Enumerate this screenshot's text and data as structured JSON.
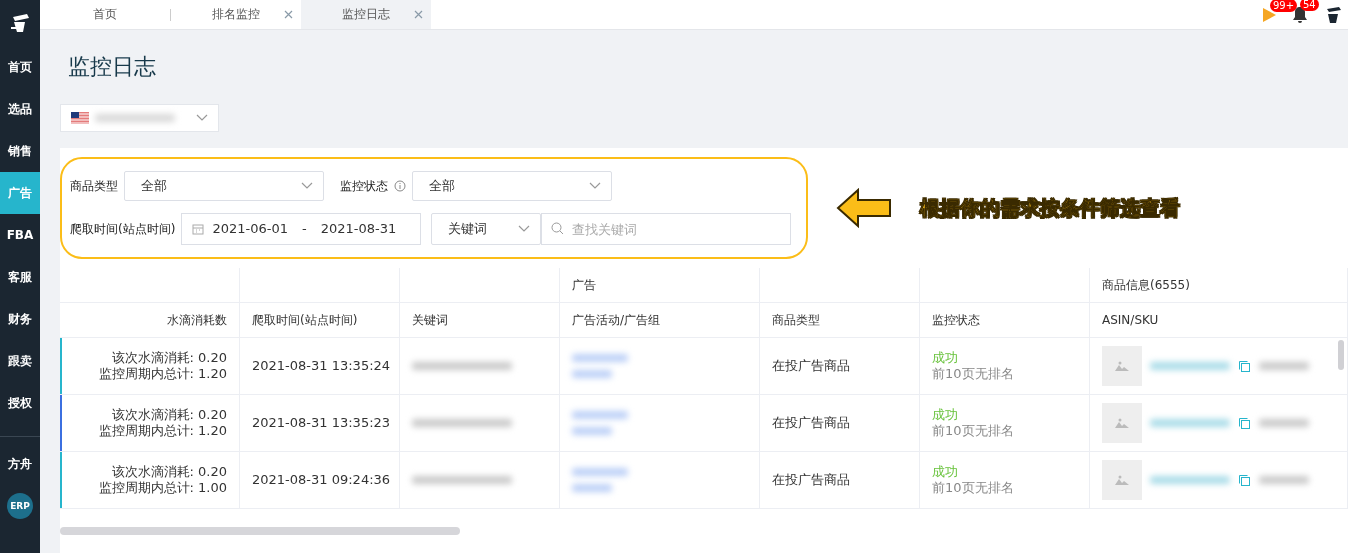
{
  "sidebar": {
    "items": [
      {
        "label": "首页",
        "selected": false
      },
      {
        "label": "选品",
        "selected": false
      },
      {
        "label": "销售",
        "selected": false
      },
      {
        "label": "广告",
        "selected": true
      },
      {
        "label": "FBA",
        "selected": false
      },
      {
        "label": "客服",
        "selected": false
      },
      {
        "label": "财务",
        "selected": false
      },
      {
        "label": "跟卖",
        "selected": false
      },
      {
        "label": "授权",
        "selected": false
      }
    ],
    "extra": [
      {
        "label": "方舟",
        "kind": "text"
      },
      {
        "label": "ERP",
        "kind": "badge"
      }
    ]
  },
  "tabs": [
    {
      "label": "首页",
      "selected": false,
      "closable": false
    },
    {
      "label": "排名监控",
      "selected": false,
      "closable": true
    },
    {
      "label": "监控日志",
      "selected": true,
      "closable": true
    }
  ],
  "header": {
    "flag_badge": "99+",
    "bell_badge": "54"
  },
  "page_title": "监控日志",
  "filters": {
    "product_type": {
      "label": "商品类型",
      "value": "全部"
    },
    "status": {
      "label": "监控状态",
      "value": "全部"
    },
    "date": {
      "label": "爬取时间(站点时间)",
      "start": "2021-06-01",
      "separator": "-",
      "end": "2021-08-31"
    },
    "search_type": "关键词",
    "search": {
      "placeholder": "查找关键词"
    }
  },
  "annotation": "根据你的需求按条件筛选查看",
  "table": {
    "columns": [
      {
        "label": "水滴消耗数"
      },
      {
        "label": "爬取时间(站点时间)"
      },
      {
        "label": "关键词"
      },
      {
        "label": "广告活动/广告组",
        "group": "广告"
      },
      {
        "label": "商品类型"
      },
      {
        "label": "监控状态"
      },
      {
        "label": "ASIN/SKU",
        "group": "商品信息(6555)"
      }
    ],
    "rows": [
      {
        "color": "#26b5cc",
        "cost": "该次水滴消耗: 0.20",
        "total": "监控周期内总计: 1.20",
        "time": "2021-08-31 13:35:24",
        "product_type": "在投广告商品",
        "status": "成功",
        "rank": "前10页无排名"
      },
      {
        "color": "#3b6fe0",
        "cost": "该次水滴消耗: 0.20",
        "total": "监控周期内总计: 1.20",
        "time": "2021-08-31 13:35:23",
        "product_type": "在投广告商品",
        "status": "成功",
        "rank": "前10页无排名"
      },
      {
        "color": "#26b5cc",
        "cost": "该次水滴消耗: 0.20",
        "total": "监控周期内总计: 1.00",
        "time": "2021-08-31 09:24:36",
        "product_type": "在投广告商品",
        "status": "成功",
        "rank": "前10页无排名"
      }
    ]
  }
}
